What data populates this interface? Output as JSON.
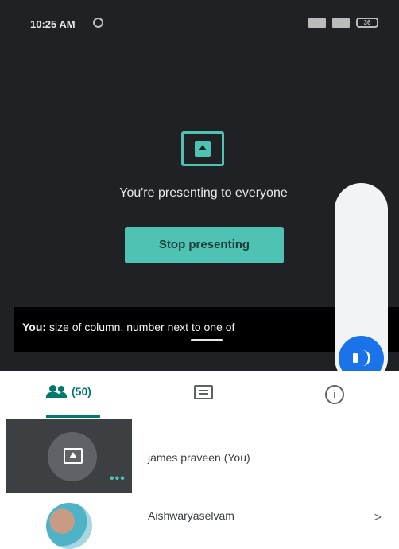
{
  "status_bar": {
    "time": "10:25 AM",
    "battery": "36"
  },
  "presenting": {
    "message": "You're presenting to everyone",
    "stop_label": "Stop presenting"
  },
  "caption": {
    "speaker": "You:",
    "text": " size of column. number next to one of"
  },
  "tabs": {
    "people_count": "(50)"
  },
  "participants": [
    {
      "name": "james praveen (You)"
    },
    {
      "name": "Aishwaryaselvam"
    }
  ],
  "colors": {
    "accent": "#4fc3b3",
    "dark_bg": "#202124",
    "blue": "#1a73e8",
    "tab_active": "#00796b"
  }
}
